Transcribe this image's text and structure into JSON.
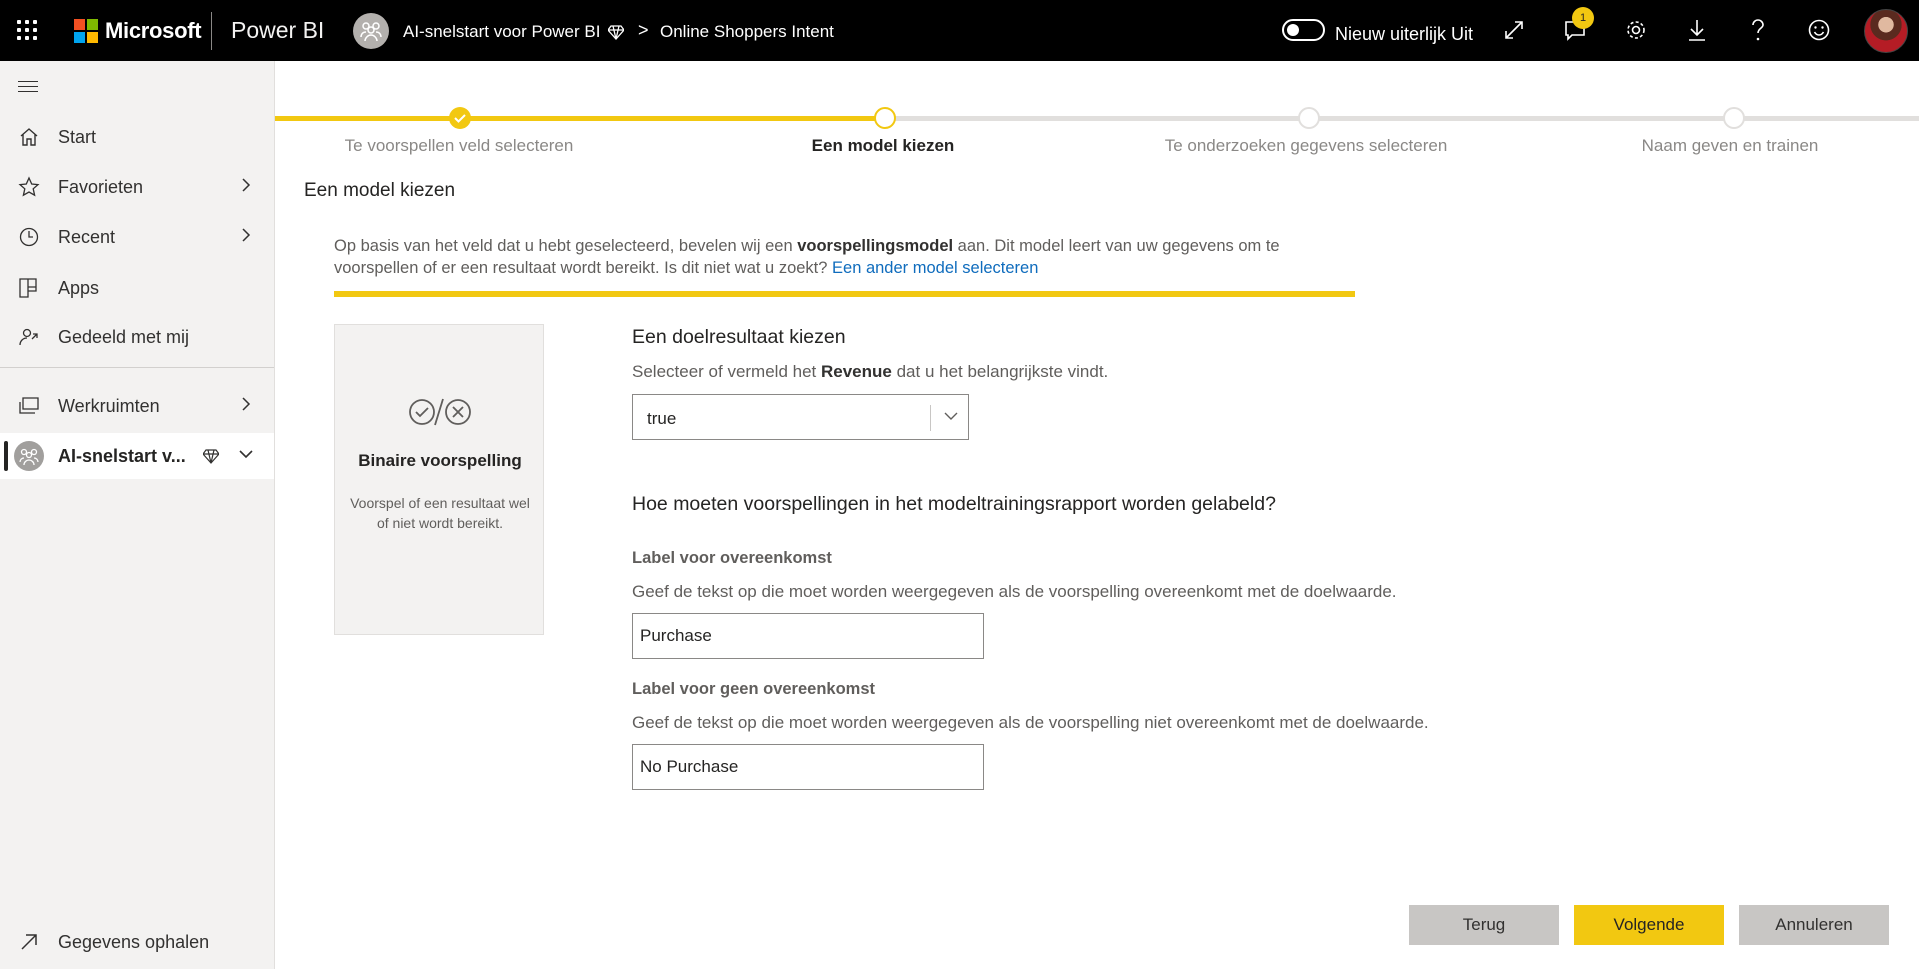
{
  "topbar": {
    "brand": "Microsoft",
    "app_name": "Power BI",
    "breadcrumb_workspace": "AI-snelstart voor Power BI",
    "breadcrumb_separator": ">",
    "breadcrumb_item": "Online Shoppers Intent",
    "toggle_label": "Nieuw uiterlijk Uit",
    "notification_count": "1",
    "icons": [
      "waffle-icon",
      "premium-diamond-icon",
      "expand-icon",
      "notifications-icon",
      "settings-icon",
      "download-icon",
      "help-icon",
      "feedback-smiley-icon"
    ]
  },
  "nav": {
    "items": [
      {
        "label": "Start",
        "icon": "home-icon"
      },
      {
        "label": "Favorieten",
        "icon": "star-icon"
      },
      {
        "label": "Recent",
        "icon": "clock-icon"
      },
      {
        "label": "Apps",
        "icon": "apps-icon"
      },
      {
        "label": "Gedeeld met mij",
        "icon": "shared-icon"
      },
      {
        "label": "Werkruimten",
        "icon": "workspaces-icon"
      },
      {
        "label": "AI-snelstart v...",
        "icon": "workspace-avatar-icon"
      }
    ],
    "bottom_item": "Gegevens ophalen"
  },
  "stepper": {
    "steps": [
      {
        "label": "Te voorspellen veld selecteren",
        "state": "complete"
      },
      {
        "label": "Een model kiezen",
        "state": "current"
      },
      {
        "label": "Te onderzoeken gegevens selecteren",
        "state": "upcoming"
      },
      {
        "label": "Naam geven en trainen",
        "state": "upcoming"
      }
    ]
  },
  "main": {
    "heading": "Een model kiezen",
    "desc_part1": "Op basis van het veld dat u hebt geselecteerd, bevelen wij een ",
    "desc_bold": "voorspellingsmodel",
    "desc_part2": " aan. Dit model leert van uw gegevens om te voorspellen of er een resultaat wordt bereikt. Is dit niet wat u zoekt? ",
    "desc_link": "Een ander model selecteren",
    "model_card": {
      "title": "Binaire voorspelling",
      "description": "Voorspel of een resultaat wel of niet wordt bereikt."
    },
    "target_heading": "Een doelresultaat kiezen",
    "target_sub_part1": "Selecteer of vermeld het ",
    "target_sub_bold": "Revenue",
    "target_sub_part2": " dat u het belangrijkste vindt.",
    "target_value": "true",
    "labels_heading": "Hoe moeten voorspellingen in het modeltrainingsrapport worden gelabeld?",
    "match_label": "Label voor overeenkomst",
    "match_help": "Geef de tekst op die moet worden weergegeven als de voorspelling overeenkomt met de doelwaarde.",
    "match_value": "Purchase",
    "nomatch_label": "Label voor geen overeenkomst",
    "nomatch_help": "Geef de tekst op die moet worden weergegeven als de voorspelling niet overeenkomt met de doelwaarde.",
    "nomatch_value": "No Purchase"
  },
  "buttons": {
    "back": "Terug",
    "next": "Volgende",
    "cancel": "Annuleren"
  },
  "colors": {
    "accent": "#F2C811",
    "topbar": "#000000",
    "link": "#0F6CBD"
  }
}
